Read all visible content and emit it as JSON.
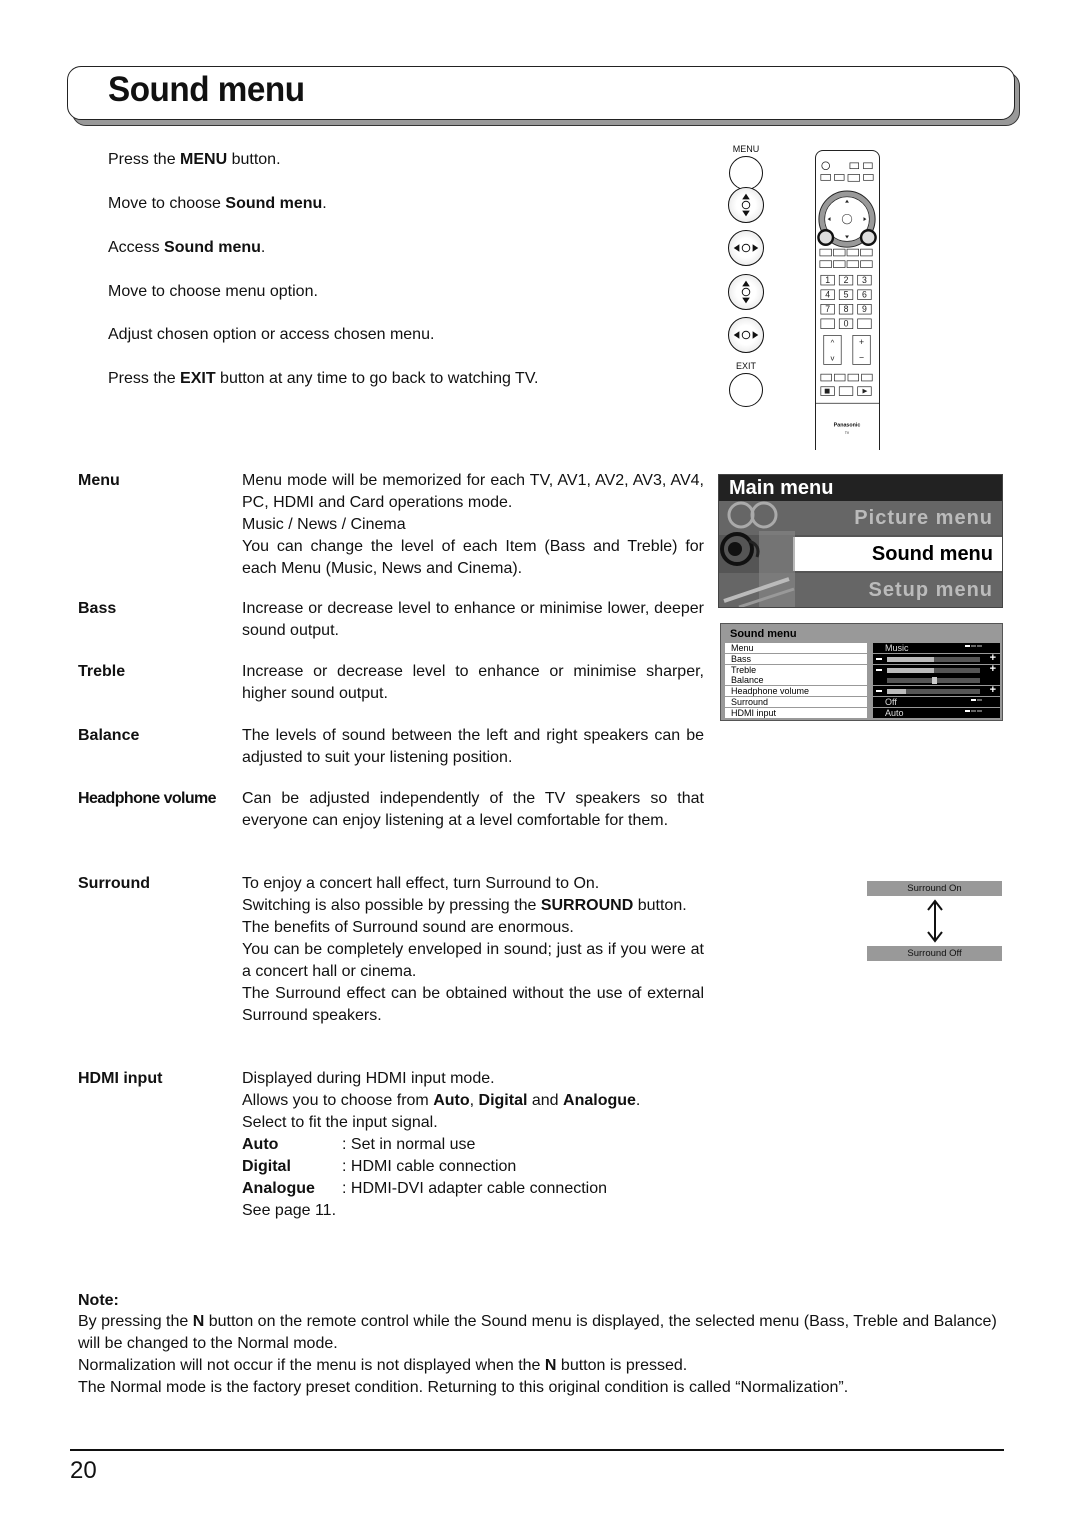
{
  "page": {
    "title": "Sound menu",
    "page_number": "20"
  },
  "steps": [
    {
      "pre": "Press the ",
      "bold": "MENU",
      "post": " button."
    },
    {
      "pre": "Move to choose ",
      "bold": "Sound menu",
      "post": "."
    },
    {
      "pre": "Access ",
      "bold": "Sound menu",
      "post": "."
    },
    {
      "pre": "Move to choose menu option.",
      "bold": "",
      "post": ""
    },
    {
      "pre": "Adjust chosen option or access chosen menu.",
      "bold": "",
      "post": ""
    },
    {
      "pre": "Press the ",
      "bold": "EXIT",
      "post": " button at any time to go back to watching TV."
    }
  ],
  "buttons": {
    "menu_label": "MENU",
    "exit_label": "EXIT"
  },
  "remote": {
    "brand": "Panasonic",
    "sub": "TV",
    "keypad": [
      "1",
      "2",
      "3",
      "4",
      "5",
      "6",
      "7",
      "8",
      "9",
      "",
      "0",
      "-/--"
    ]
  },
  "definitions": {
    "menu": {
      "term": "Menu",
      "lines": [
        "Menu mode will be memorized for each TV, AV1, AV2, AV3, AV4, PC, HDMI and Card operations mode.",
        "Music / News / Cinema",
        "You can change the level of each Item (Bass and Treble) for each Menu (Music, News and Cinema)."
      ]
    },
    "bass": {
      "term": "Bass",
      "text": "Increase or decrease level to enhance or minimise lower, deeper sound output."
    },
    "treble": {
      "term": "Treble",
      "text": "Increase or decrease level to enhance or minimise sharper, higher sound output."
    },
    "balance": {
      "term": "Balance",
      "text": "The levels of sound between the left and right speakers can be adjusted to suit your listening position."
    },
    "headphone": {
      "term": "Headphone volume",
      "text": "Can be adjusted independently of the TV speakers so that everyone can enjoy listening at a level comfortable for them."
    },
    "surround": {
      "term": "Surround",
      "line1": "To enjoy a concert hall effect, turn Surround to On.",
      "line2_pre": "Switching is also possible by pressing the ",
      "line2_bold": "SURROUND",
      "line2_post": " button.",
      "line3": "The benefits of Surround sound are enormous.",
      "line4": "You can be completely enveloped in sound; just as if you were at a concert hall or cinema.",
      "line5": "The Surround effect can be obtained without the use of external Surround speakers."
    },
    "hdmi": {
      "term": "HDMI input",
      "line1": "Displayed during HDMI input mode.",
      "line2_pre": "Allows you to choose from ",
      "opt_auto": "Auto",
      "sep1": ", ",
      "opt_digital": "Digital",
      "sep2": " and ",
      "opt_analogue": "Analogue",
      "line2_post": ".",
      "line3": "Select to fit the input signal.",
      "options": [
        {
          "k": "Auto",
          "v": ": Set in normal use"
        },
        {
          "k": "Digital",
          "v": ": HDMI cable connection"
        },
        {
          "k": "Analogue",
          "v": ": HDMI-DVI adapter cable connection"
        }
      ],
      "see": "See page 11."
    }
  },
  "main_menu_osd": {
    "header": "Main menu",
    "items": [
      "Picture menu",
      "Sound menu",
      "Setup menu"
    ],
    "selected": "Sound menu"
  },
  "sound_menu_osd": {
    "header": "Sound menu",
    "rows": [
      {
        "label": "Menu",
        "value": "Music",
        "type": "select",
        "option_index": 0,
        "option_count": 3
      },
      {
        "label": "Bass",
        "type": "slider",
        "level": 0.5
      },
      {
        "label": "Treble",
        "type": "slider",
        "level": 0.5
      },
      {
        "label": "Balance",
        "type": "balance",
        "level": 0.5
      },
      {
        "label": "Headphone volume",
        "type": "slider",
        "level": 0.2
      },
      {
        "label": "Surround",
        "value": "Off",
        "type": "select",
        "option_index": 0,
        "option_count": 2
      },
      {
        "label": "HDMI input",
        "value": "Auto",
        "type": "select",
        "option_index": 0,
        "option_count": 3
      }
    ]
  },
  "surround_toggle": {
    "on_label": "Surround On",
    "off_label": "Surround Off"
  },
  "note": {
    "heading": "Note:",
    "p1_pre": "By pressing the ",
    "p1_bold": "N",
    "p1_post": " button on the remote control while the Sound menu is displayed, the selected menu (Bass, Treble and Balance) will be changed to the Normal mode.",
    "p2_pre": "Normalization will not occur if the menu is not displayed when the ",
    "p2_bold": "N",
    "p2_post": " button is pressed.",
    "p3": "The Normal mode is the factory preset condition. Returning to this original condition is called “Normalization”."
  }
}
